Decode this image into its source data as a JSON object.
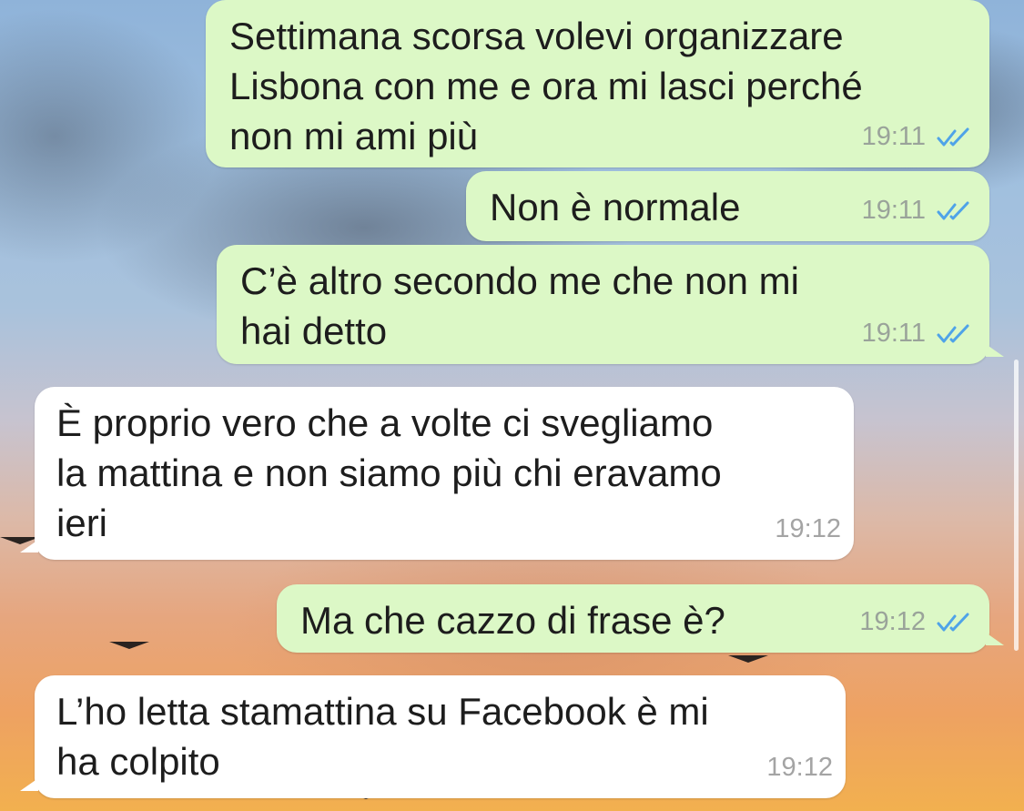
{
  "chat": {
    "messages": [
      {
        "direction": "out",
        "text": "Settimana scorsa volevi organizzare\nLisbona con me e ora mi lasci perché\nnon mi ami più",
        "time": "19:11",
        "status_icon": "double-check-icon"
      },
      {
        "direction": "out",
        "text": "Non è normale",
        "time": "19:11",
        "status_icon": "double-check-icon"
      },
      {
        "direction": "out",
        "text": "C’è altro secondo me che non mi\nhai detto",
        "time": "19:11",
        "status_icon": "double-check-icon"
      },
      {
        "direction": "in",
        "text": "È proprio vero che a volte ci svegliamo\nla mattina e non siamo più chi eravamo\nieri",
        "time": "19:12"
      },
      {
        "direction": "out",
        "text": "Ma che cazzo di frase è?",
        "time": "19:12",
        "status_icon": "double-check-icon"
      },
      {
        "direction": "in",
        "text": "L’ho letta stamattina su Facebook è mi\nha colpito",
        "time": "19:12"
      }
    ]
  },
  "colors": {
    "outgoing_bubble": "#dcf8c6",
    "incoming_bubble": "#ffffff",
    "read_ticks": "#4fa3e8",
    "timestamp": "#9aa39a"
  }
}
